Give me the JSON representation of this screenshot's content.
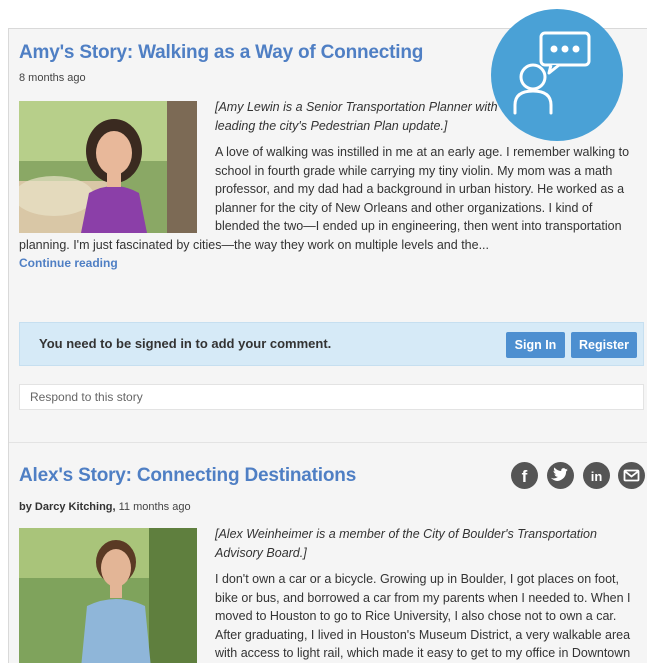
{
  "story1": {
    "title": "Amy's Story: Walking as a Way of Connecting",
    "meta": "8 months ago",
    "intro": "[Amy Lewin is a Senior Transportation Planner with GO Boulder and is leading the city's Pedestrian Plan update.]",
    "body": "A love of walking was instilled in me at an early age. I remember walking to school in fourth grade while carrying my tiny violin. My mom was a math professor, and my dad had a background in urban history. He worked as a planner for the city of New Orleans and other organizations. I kind of blended the two—I ended up in engineering, then went into transportation planning. I'm just fascinated by cities—the way they work on multiple levels and the...",
    "continue_label": "Continue reading"
  },
  "comment": {
    "signin_text": "You need to be signed in to add your comment.",
    "signin_button": "Sign In",
    "register_button": "Register",
    "respond_placeholder": "Respond to this story"
  },
  "story2": {
    "title": "Alex's Story: Connecting Destinations",
    "author": "by Darcy Kitching,",
    "meta": " 11 months ago",
    "intro": "[Alex Weinheimer is a member of the City of Boulder's Transportation Advisory Board.]",
    "body": "I don't own a car or a bicycle. Growing up in Boulder, I got places on foot, bike or bus, and borrowed a car from my parents when I needed to. When I moved to Houston to go to Rice University, I also chose not to own a car. After graduating, I lived in Houston's Museum District, a very walkable area with access to light rail, which made it easy to get to my office in Downtown"
  },
  "share_icons": [
    "facebook-icon",
    "twitter-icon",
    "linkedin-icon",
    "email-icon"
  ],
  "colors": {
    "accent_blue": "#4f7fc4",
    "button_blue": "#4d8fd0",
    "signin_bar": "#d6eaf7",
    "badge_blue": "#4aa1d6",
    "social_gray": "#555555"
  }
}
